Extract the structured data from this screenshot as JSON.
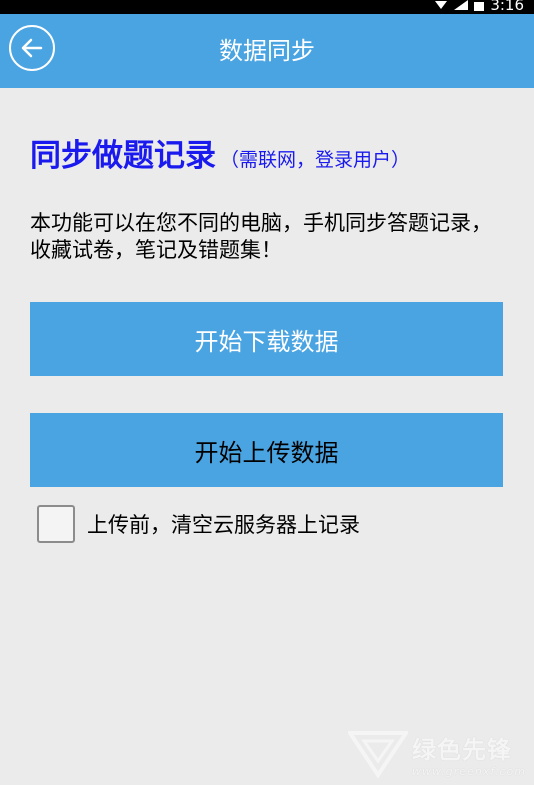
{
  "status_bar": {
    "time": "3:16"
  },
  "app_bar": {
    "title": "数据同步",
    "back_icon": "back-arrow-icon"
  },
  "content": {
    "heading": "同步做题记录",
    "heading_note": "（需联网，登录用户）",
    "description": "本功能可以在您不同的电脑，手机同步答题记录， 收藏试卷，笔记及错题集！",
    "download_button": "开始下载数据",
    "upload_button": "开始上传数据",
    "clear_checkbox": {
      "label": "上传前，清空云服务器上记录",
      "checked": false
    }
  },
  "watermark": {
    "name": "绿色先锋",
    "url": "www.greenxf.com"
  },
  "colors": {
    "accent": "#4aa4e2",
    "heading": "#1a1aee",
    "background": "#ebebeb"
  }
}
